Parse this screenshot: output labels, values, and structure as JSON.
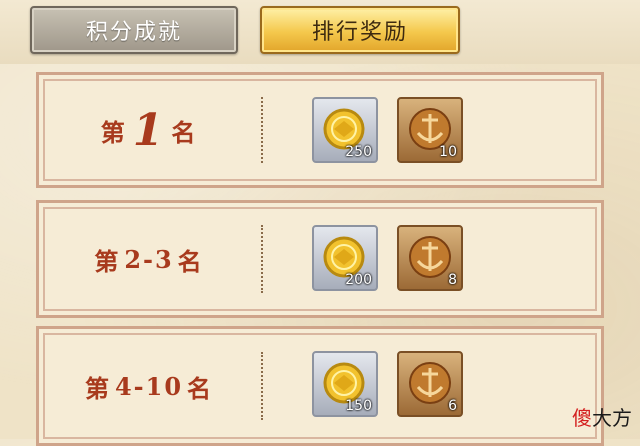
{
  "tabs": [
    {
      "label": "积分成就",
      "active": false
    },
    {
      "label": "排行奖励",
      "active": true
    }
  ],
  "ranks": [
    {
      "prefix": "第",
      "number": "1",
      "suffix": "名",
      "rewards": [
        {
          "icon": "gold-coin-icon",
          "count": "250"
        },
        {
          "icon": "anchor-emblem-icon",
          "count": "10"
        }
      ]
    },
    {
      "prefix": "第",
      "number": "2-3",
      "suffix": "名",
      "rewards": [
        {
          "icon": "gold-coin-icon",
          "count": "200"
        },
        {
          "icon": "anchor-emblem-icon",
          "count": "8"
        }
      ]
    },
    {
      "prefix": "第",
      "number": "4-10",
      "suffix": "名",
      "rewards": [
        {
          "icon": "gold-coin-icon",
          "count": "150"
        },
        {
          "icon": "anchor-emblem-icon",
          "count": "6"
        }
      ]
    }
  ],
  "watermark": {
    "first": "傻",
    "rest": "大方"
  },
  "colors": {
    "rank_text": "#a83a1d",
    "active_tab": "#f4c84c",
    "inactive_tab": "#a9a294"
  }
}
